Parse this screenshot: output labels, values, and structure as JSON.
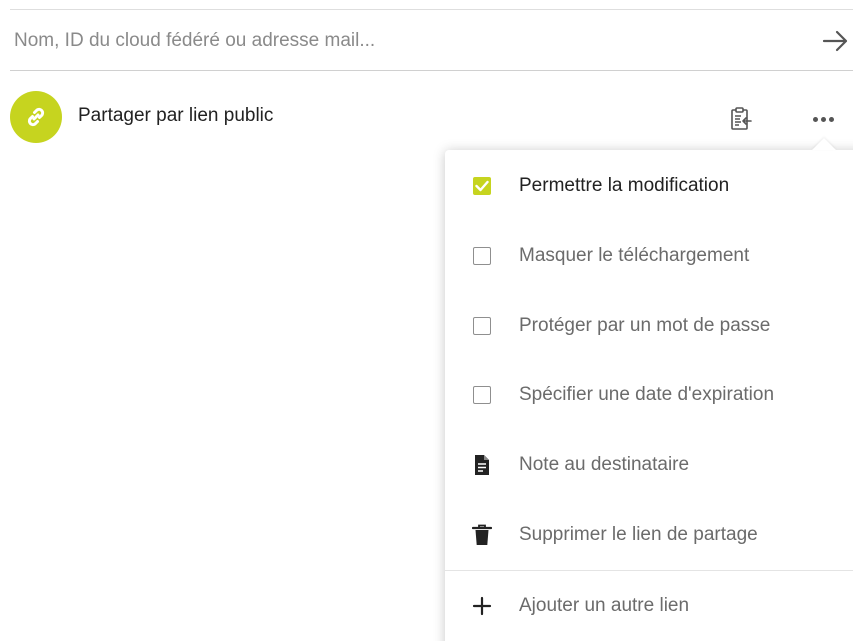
{
  "search": {
    "placeholder": "Nom, ID du cloud fédéré ou adresse mail...",
    "value": ""
  },
  "share": {
    "label": "Partager par lien public",
    "avatar_color": "#c6d41f",
    "avatar_icon": "link-icon",
    "copy_icon": "clipboard-icon",
    "more_icon": "more-horizontal-icon"
  },
  "menu": {
    "items": [
      {
        "label": "Permettre la modification",
        "type": "checkbox",
        "checked": true
      },
      {
        "label": "Masquer le téléchargement",
        "type": "checkbox",
        "checked": false
      },
      {
        "label": "Protéger par un mot de passe",
        "type": "checkbox",
        "checked": false
      },
      {
        "label": "Spécifier une date d'expiration",
        "type": "checkbox",
        "checked": false
      },
      {
        "label": "Note au destinataire",
        "type": "action",
        "icon": "note-icon"
      },
      {
        "label": "Supprimer le lien de partage",
        "type": "action",
        "icon": "trash-icon"
      },
      {
        "label": "Ajouter un autre lien",
        "type": "action",
        "icon": "plus-icon"
      }
    ]
  },
  "colors": {
    "accent": "#c6d41f",
    "text": "#222222",
    "muted_text": "#6b6b6b",
    "placeholder": "#8a8a8a"
  }
}
